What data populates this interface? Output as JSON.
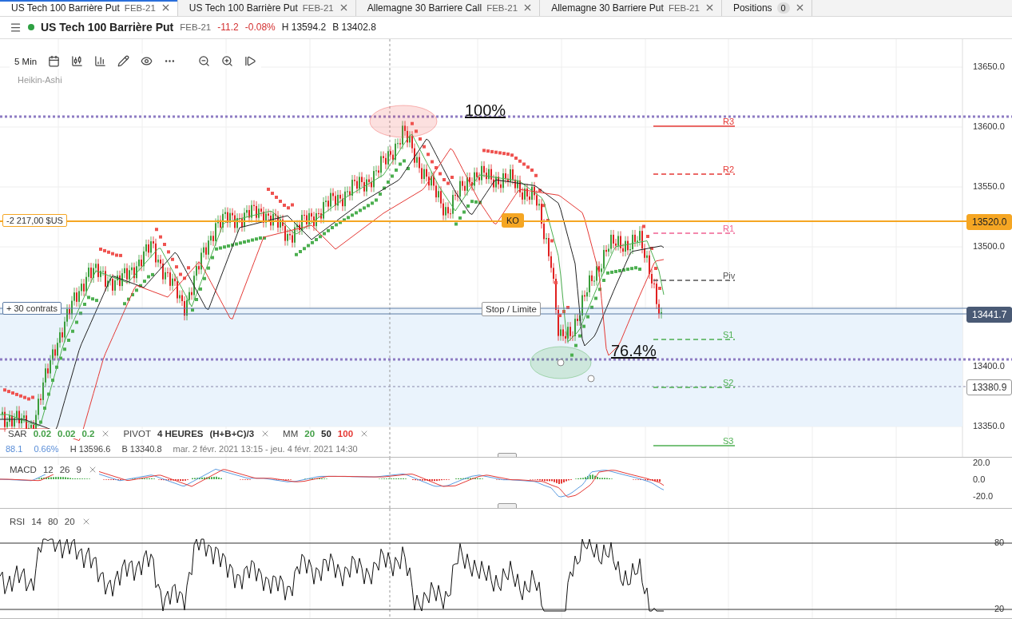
{
  "tabs": [
    {
      "label": "US Tech 100 Barrière Put",
      "contract": "FEB-21",
      "selected": true
    },
    {
      "label": "US Tech 100 Barrière Put",
      "contract": "FEB-21",
      "selected": false
    },
    {
      "label": "Allemagne 30 Barriere Call",
      "contract": "FEB-21",
      "selected": false
    },
    {
      "label": "Allemagne 30 Barriere Put",
      "contract": "FEB-21",
      "selected": false
    }
  ],
  "positions_tab": {
    "label": "Positions",
    "count": "0",
    "selected": false
  },
  "header": {
    "title": "US Tech 100 Barrière Put",
    "contract": "FEB-21",
    "change": "-11.2",
    "change_pct": "-0.08%",
    "high": "H 13594.2",
    "low": "B 13402.8"
  },
  "toolbar": {
    "timeframe": "5 Min",
    "chart_type": "Heikin-Ashi"
  },
  "price_axis": [
    "13650.0",
    "13600.0",
    "13550.0",
    "13500.0",
    "13400.0",
    "13350.0"
  ],
  "knockout": {
    "label": "KO",
    "price": "13520.0",
    "pnl": "-2 217,00 $US"
  },
  "position": {
    "contracts": "+ 30 contrats",
    "stop_label": "Stop / Limite",
    "price": "13441.7",
    "cursor_price": "13380.9"
  },
  "fibonacci": [
    "100%",
    "76.4%"
  ],
  "pivot_levels": [
    {
      "label": "R3",
      "color": "#e53935",
      "kind": "solid"
    },
    {
      "label": "R2",
      "color": "#e53935",
      "kind": "dashed"
    },
    {
      "label": "R1",
      "color": "#f06292",
      "kind": "dashed"
    },
    {
      "label": "Piv",
      "color": "#555555",
      "kind": "dashed"
    },
    {
      "label": "S1",
      "color": "#4caf50",
      "kind": "dashed"
    },
    {
      "label": "S2",
      "color": "#4caf50",
      "kind": "dashed"
    },
    {
      "label": "S3",
      "color": "#4caf50",
      "kind": "solid"
    }
  ],
  "legend": [
    {
      "name": "SAR",
      "params": [
        {
          "text": "0.02",
          "color": "#43a047"
        },
        {
          "text": "0.02",
          "color": "#43a047"
        },
        {
          "text": "0.2",
          "color": "#43a047"
        }
      ]
    },
    {
      "name": "PIVOT",
      "params": [
        {
          "text": "4 HEURES",
          "color": "#333333"
        },
        {
          "text": "(H+B+C)/3",
          "color": "#333333"
        }
      ]
    },
    {
      "name": "MM",
      "params": [
        {
          "text": "20",
          "color": "#43a047"
        },
        {
          "text": "50",
          "color": "#222222"
        },
        {
          "text": "100",
          "color": "#e53935"
        }
      ]
    }
  ],
  "info": {
    "value": "88.1",
    "pct": "0.66%",
    "high": "H 13596.6",
    "low": "B 13340.8",
    "range": "mar. 2 févr. 2021 13:15 - jeu. 4 févr. 2021 14:30"
  },
  "macd": {
    "label": "MACD",
    "params": [
      "12",
      "26",
      "9"
    ],
    "axis": [
      "20.0",
      "0.0",
      "-20.0"
    ]
  },
  "rsi": {
    "label": "RSI",
    "params": [
      "14",
      "80",
      "20"
    ],
    "axis": [
      "80",
      "20"
    ]
  }
}
